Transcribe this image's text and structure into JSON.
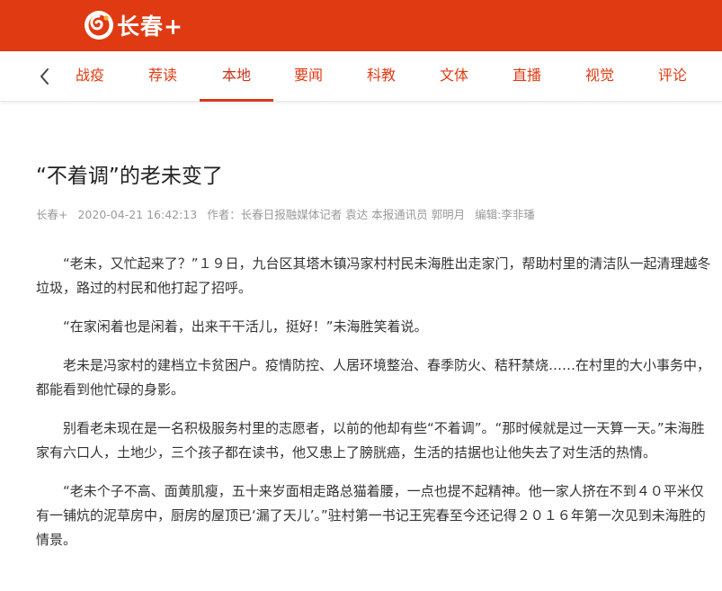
{
  "header": {
    "brand": "长春+",
    "logo_icon": "changchun-swirl-logo-icon",
    "brand_color": "#e03a12"
  },
  "nav": {
    "back_icon": "chevron-left-icon",
    "tabs": [
      {
        "label": "战疫"
      },
      {
        "label": "荐读"
      },
      {
        "label": "本地"
      },
      {
        "label": "要闻"
      },
      {
        "label": "科教"
      },
      {
        "label": "文体"
      },
      {
        "label": "直播"
      },
      {
        "label": "视觉"
      },
      {
        "label": "评论"
      }
    ],
    "active_tab": "本地"
  },
  "article": {
    "title": "“不着调”的老未变了",
    "source": "长春+",
    "datetime": "2020-04-21 16:42:13",
    "author": "作者：长春日报融媒体记者 袁达 本报通讯员 郭明月",
    "editor": "编辑:李非璠",
    "paragraphs": [
      "“老未，又忙起来了？”１９日，九台区其塔木镇冯家村村民未海胜出走家门，帮助村里的清洁队一起清理越冬垃圾，路过的村民和他打起了招呼。",
      "“在家闲着也是闲着，出来干干活儿，挺好！”未海胜笑着说。",
      "老未是冯家村的建档立卡贫困户。疫情防控、人居环境整治、春季防火、秸秆禁烧……在村里的大小事务中，都能看到他忙碌的身影。",
      "别看老未现在是一名积极服务村里的志愿者，以前的他却有些“不着调”。“那时候就是过一天算一天。”未海胜家有六口人，土地少，三个孩子都在读书，他又患上了膀胱癌，生活的拮据也让他失去了对生活的热情。",
      "“老未个子不高、面黄肌瘦，五十来岁面相走路总猫着腰，一点也提不起精神。他一家人挤在不到４０平米仅有一铺炕的泥草房中，厨房的屋顶已‘漏了天儿’。”驻村第一书记王宪春至今还记得２０１６年第一次见到未海胜的情景。"
    ]
  }
}
